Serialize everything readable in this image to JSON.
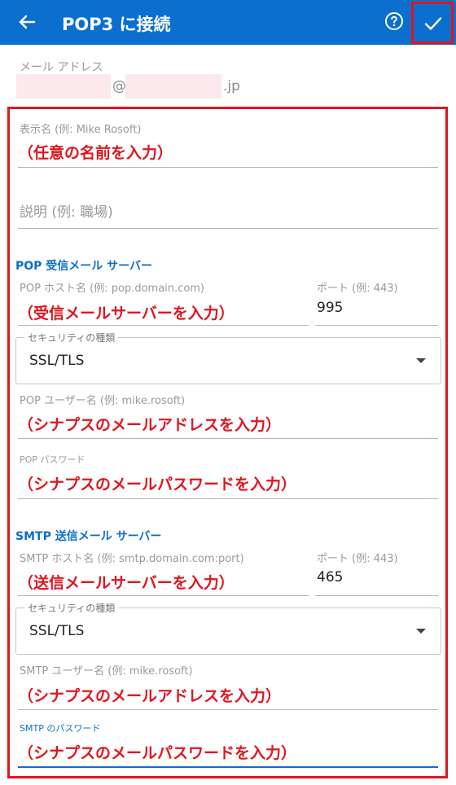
{
  "appbar": {
    "title": "POP3 に接続"
  },
  "email": {
    "label": "メール アドレス",
    "at": "@",
    "domain_suffix": ".jp"
  },
  "display_name": {
    "label": "表示名 (例: Mike Rosoft)",
    "annotation": "（任意の名前を入力）"
  },
  "description": {
    "placeholder": "説明 (例: 職場)"
  },
  "pop": {
    "section_title": "POP 受信メール サーバー",
    "host_label": "POP ホスト名 (例: pop.domain.com)",
    "host_annotation": "（受信メールサーバーを入力）",
    "port_label": "ポート (例: 443)",
    "port_value": "995",
    "security_label": "セキュリティの種類",
    "security_value": "SSL/TLS",
    "user_label": "POP ユーザー名 (例: mike.rosoft)",
    "user_annotation": "（シナプスのメールアドレスを入力）",
    "password_label": "POP パスワード",
    "password_annotation": "（シナプスのメールパスワードを入力）"
  },
  "smtp": {
    "section_title": "SMTP 送信メール サーバー",
    "host_label": "SMTP ホスト名 (例: smtp.domain.com:port)",
    "host_annotation": "（送信メールサーバーを入力）",
    "port_label": "ポート (例: 443)",
    "port_value": "465",
    "security_label": "セキュリティの種類",
    "security_value": "SSL/TLS",
    "user_label": "SMTP ユーザー名 (例: mike.rosoft)",
    "user_annotation": "（シナプスのメールアドレスを入力）",
    "password_label": "SMTP のパスワード",
    "password_annotation": "（シナプスのメールパスワードを入力）"
  },
  "colors": {
    "appbar": "#0a6fce",
    "annotation": "#e0161e",
    "accent": "#0a6fce"
  },
  "icons": {
    "back": "arrow-left-icon",
    "help": "help-circle-icon",
    "confirm": "check-icon",
    "dropdown": "chevron-down-icon"
  }
}
